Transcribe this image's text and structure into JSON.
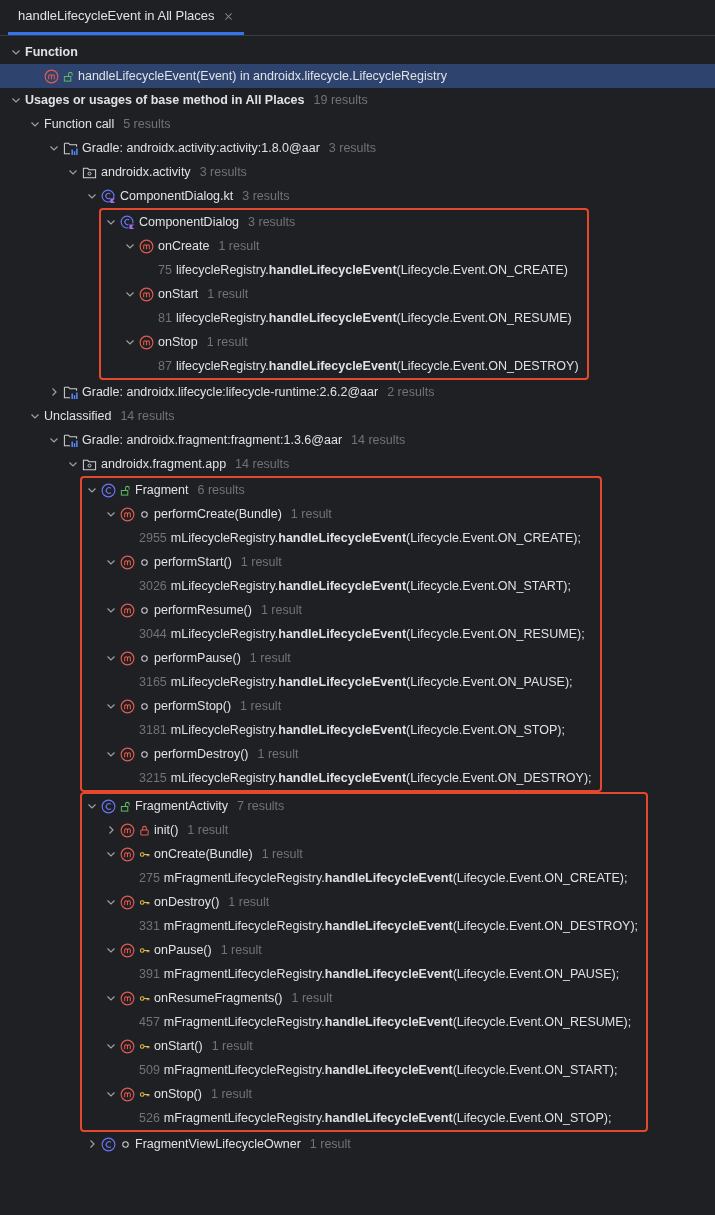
{
  "tab": {
    "label": "handleLifecycleEvent in All Places",
    "selected": true
  },
  "tree": [
    {
      "kind": "section",
      "label": "Function",
      "expanded": true,
      "selected": false,
      "children": [
        {
          "kind": "method",
          "public": true,
          "label": "handleLifecycleEvent(Event) in androidx.lifecycle.LifecycleRegistry",
          "selected": true
        }
      ]
    },
    {
      "kind": "section",
      "label": "Usages or usages of base method in All Places",
      "count": "19 results",
      "expanded": true,
      "selected": false,
      "children": [
        {
          "kind": "group",
          "label": "Function call",
          "count": "5 results",
          "expanded": true,
          "selected": false,
          "children": [
            {
              "kind": "gradle",
              "label": "Gradle: androidx.activity:activity:1.8.0@aar",
              "count": "3 results",
              "expanded": true,
              "selected": false,
              "children": [
                {
                  "kind": "package",
                  "label": "androidx.activity",
                  "count": "3 results",
                  "expanded": true,
                  "selected": false,
                  "children": [
                    {
                      "kind": "kotlin-file",
                      "label": "ComponentDialog.kt",
                      "count": "3 results",
                      "expanded": true,
                      "selected": false,
                      "children": [
                        {
                          "kind": "kotlin-class",
                          "label": "ComponentDialog",
                          "count": "3 results",
                          "expanded": true,
                          "selected": false,
                          "outlined": true,
                          "children": [
                            {
                              "kind": "method",
                              "label": "onCreate",
                              "count": "1 result",
                              "expanded": true,
                              "selected": false,
                              "children": [
                                {
                                  "kind": "usage",
                                  "line": "75",
                                  "code": "lifecycleRegistry.**handleLifecycleEvent**(Lifecycle.Event.ON_CREATE)",
                                  "selected": false
                                }
                              ]
                            },
                            {
                              "kind": "method",
                              "label": "onStart",
                              "count": "1 result",
                              "expanded": true,
                              "selected": false,
                              "children": [
                                {
                                  "kind": "usage",
                                  "line": "81",
                                  "code": "lifecycleRegistry.**handleLifecycleEvent**(Lifecycle.Event.ON_RESUME)",
                                  "selected": false
                                }
                              ]
                            },
                            {
                              "kind": "method",
                              "label": "onStop",
                              "count": "1 result",
                              "expanded": true,
                              "selected": false,
                              "children": [
                                {
                                  "kind": "usage",
                                  "line": "87",
                                  "code": "lifecycleRegistry.**handleLifecycleEvent**(Lifecycle.Event.ON_DESTROY)",
                                  "selected": false
                                }
                              ]
                            }
                          ]
                        }
                      ]
                    }
                  ]
                }
              ]
            },
            {
              "kind": "gradle",
              "label": "Gradle: androidx.lifecycle:lifecycle-runtime:2.6.2@aar",
              "count": "2 results",
              "expanded": false,
              "selected": false
            }
          ]
        },
        {
          "kind": "group",
          "label": "Unclassified",
          "count": "14 results",
          "expanded": true,
          "selected": false,
          "children": [
            {
              "kind": "gradle",
              "label": "Gradle: androidx.fragment:fragment:1.3.6@aar",
              "count": "14 results",
              "expanded": true,
              "selected": false,
              "children": [
                {
                  "kind": "package",
                  "label": "androidx.fragment.app",
                  "count": "14 results",
                  "expanded": true,
                  "selected": false,
                  "children": [
                    {
                      "kind": "class",
                      "public": true,
                      "label": "Fragment",
                      "count": "6 results",
                      "expanded": true,
                      "selected": false,
                      "outlined": true,
                      "children": [
                        {
                          "kind": "method",
                          "package_private": true,
                          "label": "performCreate(Bundle)",
                          "count": "1 result",
                          "expanded": true,
                          "selected": false,
                          "children": [
                            {
                              "kind": "usage",
                              "line": "2955",
                              "code": "mLifecycleRegistry.**handleLifecycleEvent**(Lifecycle.Event.ON_CREATE);",
                              "selected": false
                            }
                          ]
                        },
                        {
                          "kind": "method",
                          "package_private": true,
                          "label": "performStart()",
                          "count": "1 result",
                          "expanded": true,
                          "selected": false,
                          "children": [
                            {
                              "kind": "usage",
                              "line": "3026",
                              "code": "mLifecycleRegistry.**handleLifecycleEvent**(Lifecycle.Event.ON_START);",
                              "selected": false
                            }
                          ]
                        },
                        {
                          "kind": "method",
                          "package_private": true,
                          "label": "performResume()",
                          "count": "1 result",
                          "expanded": true,
                          "selected": false,
                          "children": [
                            {
                              "kind": "usage",
                              "line": "3044",
                              "code": "mLifecycleRegistry.**handleLifecycleEvent**(Lifecycle.Event.ON_RESUME);",
                              "selected": false
                            }
                          ]
                        },
                        {
                          "kind": "method",
                          "package_private": true,
                          "label": "performPause()",
                          "count": "1 result",
                          "expanded": true,
                          "selected": false,
                          "children": [
                            {
                              "kind": "usage",
                              "line": "3165",
                              "code": "mLifecycleRegistry.**handleLifecycleEvent**(Lifecycle.Event.ON_PAUSE);",
                              "selected": false
                            }
                          ]
                        },
                        {
                          "kind": "method",
                          "package_private": true,
                          "label": "performStop()",
                          "count": "1 result",
                          "expanded": true,
                          "selected": false,
                          "children": [
                            {
                              "kind": "usage",
                              "line": "3181",
                              "code": "mLifecycleRegistry.**handleLifecycleEvent**(Lifecycle.Event.ON_STOP);",
                              "selected": false
                            }
                          ]
                        },
                        {
                          "kind": "method",
                          "package_private": true,
                          "label": "performDestroy()",
                          "count": "1 result",
                          "expanded": true,
                          "selected": false,
                          "children": [
                            {
                              "kind": "usage",
                              "line": "3215",
                              "code": "mLifecycleRegistry.**handleLifecycleEvent**(Lifecycle.Event.ON_DESTROY);",
                              "selected": false
                            }
                          ]
                        }
                      ]
                    },
                    {
                      "kind": "class",
                      "public": true,
                      "label": "FragmentActivity",
                      "count": "7 results",
                      "expanded": true,
                      "selected": false,
                      "outlined": true,
                      "children": [
                        {
                          "kind": "method",
                          "private": true,
                          "label": "init()",
                          "count": "1 result",
                          "expanded": false,
                          "selected": false
                        },
                        {
                          "kind": "method",
                          "protected": true,
                          "label": "onCreate(Bundle)",
                          "count": "1 result",
                          "expanded": true,
                          "selected": false,
                          "children": [
                            {
                              "kind": "usage",
                              "line": "275",
                              "code": "mFragmentLifecycleRegistry.**handleLifecycleEvent**(Lifecycle.Event.ON_CREATE);",
                              "selected": false
                            }
                          ]
                        },
                        {
                          "kind": "method",
                          "protected": true,
                          "label": "onDestroy()",
                          "count": "1 result",
                          "expanded": true,
                          "selected": false,
                          "children": [
                            {
                              "kind": "usage",
                              "line": "331",
                              "code": "mFragmentLifecycleRegistry.**handleLifecycleEvent**(Lifecycle.Event.ON_DESTROY);",
                              "selected": false
                            }
                          ]
                        },
                        {
                          "kind": "method",
                          "protected": true,
                          "label": "onPause()",
                          "count": "1 result",
                          "expanded": true,
                          "selected": false,
                          "children": [
                            {
                              "kind": "usage",
                              "line": "391",
                              "code": "mFragmentLifecycleRegistry.**handleLifecycleEvent**(Lifecycle.Event.ON_PAUSE);",
                              "selected": false
                            }
                          ]
                        },
                        {
                          "kind": "method",
                          "protected": true,
                          "label": "onResumeFragments()",
                          "count": "1 result",
                          "expanded": true,
                          "selected": false,
                          "children": [
                            {
                              "kind": "usage",
                              "line": "457",
                              "code": "mFragmentLifecycleRegistry.**handleLifecycleEvent**(Lifecycle.Event.ON_RESUME);",
                              "selected": false
                            }
                          ]
                        },
                        {
                          "kind": "method",
                          "protected": true,
                          "label": "onStart()",
                          "count": "1 result",
                          "expanded": true,
                          "selected": false,
                          "children": [
                            {
                              "kind": "usage",
                              "line": "509",
                              "code": "mFragmentLifecycleRegistry.**handleLifecycleEvent**(Lifecycle.Event.ON_START);",
                              "selected": false
                            }
                          ]
                        },
                        {
                          "kind": "method",
                          "protected": true,
                          "label": "onStop()",
                          "count": "1 result",
                          "expanded": true,
                          "selected": false,
                          "children": [
                            {
                              "kind": "usage",
                              "line": "526",
                              "code": "mFragmentLifecycleRegistry.**handleLifecycleEvent**(Lifecycle.Event.ON_STOP);",
                              "selected": false
                            }
                          ]
                        }
                      ]
                    },
                    {
                      "kind": "class",
                      "package_private": true,
                      "label": "FragmentViewLifecycleOwner",
                      "count": "1 result",
                      "expanded": false,
                      "selected": false
                    }
                  ]
                }
              ]
            }
          ]
        }
      ]
    }
  ]
}
